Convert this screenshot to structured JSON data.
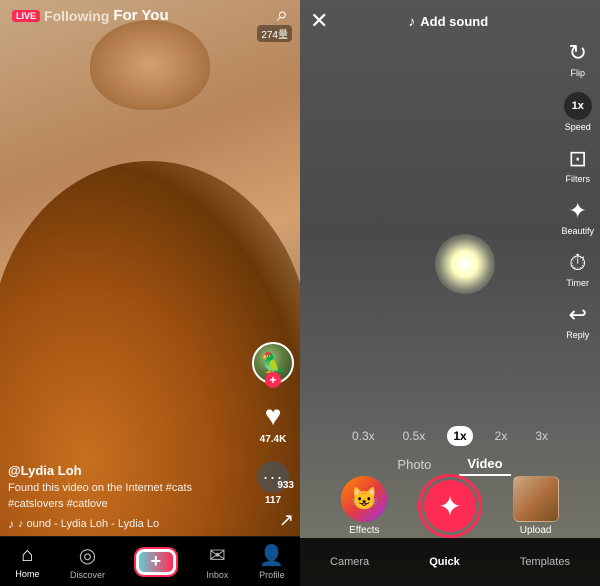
{
  "left": {
    "nav": {
      "live_label": "LIVE",
      "following_label": "Following",
      "foryou_label": "For You",
      "search_icon": "🔍"
    },
    "video": {
      "view_count": "274量",
      "username": "@Lydia Loh",
      "caption": "Found this video on the Internet #cats #catslovers #catlove",
      "music": "♪ ound - Lydia Loh - Lydia Lo"
    },
    "actions": {
      "like_icon": "♥",
      "like_count": "47.4K",
      "comment_icon": "💬",
      "comment_count": "117",
      "share_count": "933"
    },
    "bottom_nav": {
      "home": "Home",
      "discover": "Discover",
      "create": "+",
      "inbox": "Inbox",
      "profile": "Profile"
    }
  },
  "right": {
    "header": {
      "close_icon": "✕",
      "add_sound_label": "Add sound",
      "music_icon": "♪"
    },
    "tools": {
      "flip_label": "Flip",
      "speed_label": "Speed",
      "speed_value": "1x",
      "filters_label": "Filters",
      "beautify_label": "Beautify",
      "timer_label": "Timer",
      "reply_label": "Reply"
    },
    "zoom": {
      "options": [
        "0.3x",
        "0.5x",
        "1x",
        "2x",
        "3x"
      ],
      "active": "1x"
    },
    "modes": {
      "photo_label": "Photo",
      "video_label": "Video"
    },
    "bottom": {
      "effects_label": "Effects",
      "upload_label": "Upload",
      "camera_label": "Camera",
      "quick_label": "Quick",
      "templates_label": "Templates"
    }
  }
}
